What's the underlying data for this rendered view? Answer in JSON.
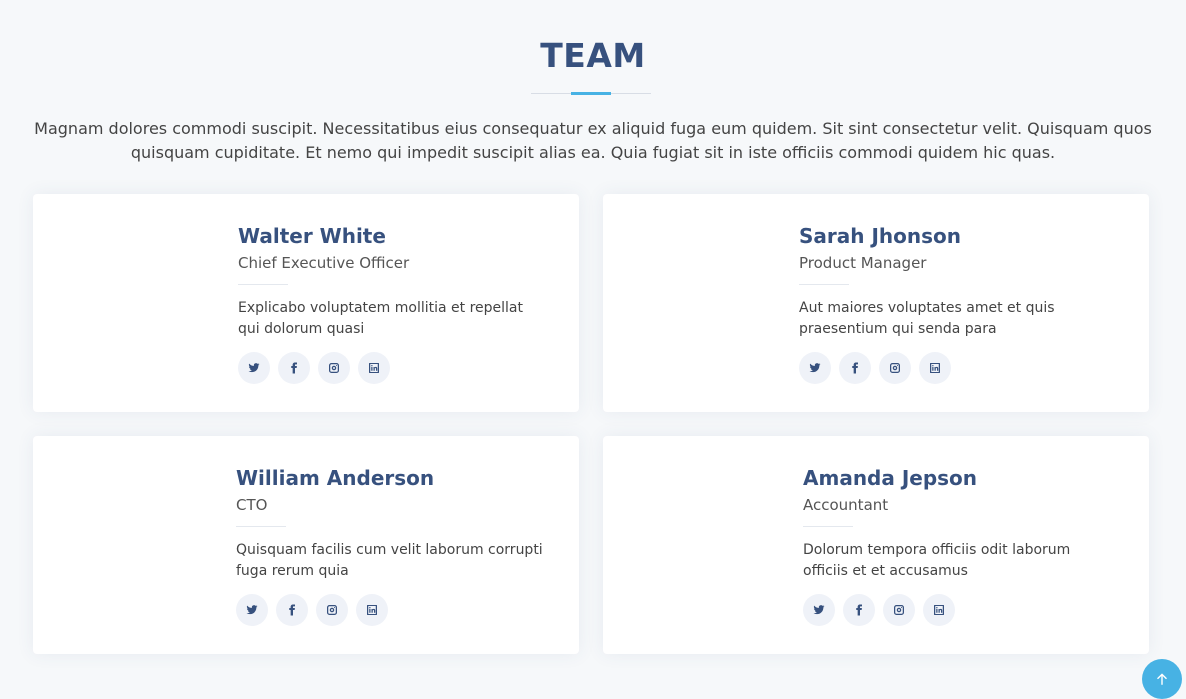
{
  "section": {
    "title": "TEAM",
    "intro": "Magnam dolores commodi suscipit. Necessitatibus eius consequatur ex aliquid fuga eum quidem. Sit sint consectetur velit. Quisquam quos quisquam cupiditate. Et nemo qui impedit suscipit alias ea. Quia fugiat sit in iste officiis commodi quidem hic quas."
  },
  "members": [
    {
      "name": "Walter White",
      "role": "Chief Executive Officer",
      "desc": "Explicabo voluptatem mollitia et repellat qui dolorum quasi"
    },
    {
      "name": "Sarah Jhonson",
      "role": "Product Manager",
      "desc": "Aut maiores voluptates amet et quis praesentium qui senda para"
    },
    {
      "name": "William Anderson",
      "role": "CTO",
      "desc": "Quisquam facilis cum velit laborum corrupti fuga rerum quia"
    },
    {
      "name": "Amanda Jepson",
      "role": "Accountant",
      "desc": "Dolorum tempora officiis odit laborum officiis et et accusamus"
    }
  ],
  "social_icons": [
    "twitter-icon",
    "facebook-icon",
    "instagram-icon",
    "linkedin-icon"
  ],
  "colors": {
    "heading": "#37517e",
    "accent": "#47b2e4",
    "background": "#f6f8fa",
    "card": "#ffffff",
    "social_bg": "#eff2f8"
  }
}
